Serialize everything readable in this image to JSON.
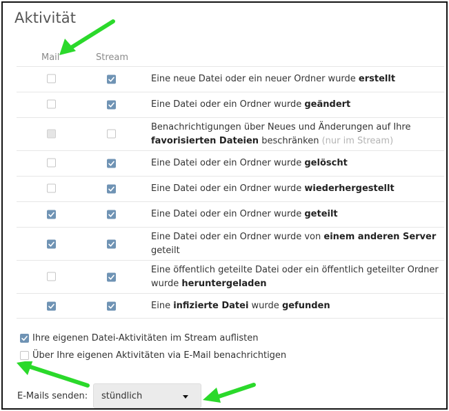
{
  "section": {
    "title": "Aktivität"
  },
  "columns": {
    "mail": "Mail",
    "stream": "Stream"
  },
  "rows": [
    {
      "mail": "unchecked",
      "stream": "checked",
      "text_before": "Eine neue Datei oder ein neuer Ordner wurde ",
      "bold": "erstellt",
      "text_after": ""
    },
    {
      "mail": "unchecked",
      "stream": "checked",
      "text_before": "Eine Datei oder ein Ordner wurde ",
      "bold": "geändert",
      "text_after": ""
    },
    {
      "mail": "disabled",
      "stream": "unchecked",
      "text_before": "Benachrichtigungen über Neues und Änderungen auf Ihre ",
      "bold": "favorisierten Dateien",
      "text_after": " beschränken ",
      "muted": "(nur im Stream)"
    },
    {
      "mail": "unchecked",
      "stream": "checked",
      "text_before": "Eine Datei oder ein Ordner wurde ",
      "bold": "gelöscht",
      "text_after": ""
    },
    {
      "mail": "unchecked",
      "stream": "checked",
      "text_before": "Eine Datei oder ein Ordner wurde ",
      "bold": "wiederhergestellt",
      "text_after": ""
    },
    {
      "mail": "checked",
      "stream": "checked",
      "text_before": "Eine Datei oder ein Ordner wurde ",
      "bold": "geteilt",
      "text_after": ""
    },
    {
      "mail": "checked",
      "stream": "checked",
      "text_before": "Eine Datei oder ein Ordner wurde von ",
      "bold": "einem anderen Server",
      "text_after": " geteilt"
    },
    {
      "mail": "unchecked",
      "stream": "checked",
      "text_before": "Eine öffentlich geteilte Datei oder ein öffentlich geteilter Ordner wurde ",
      "bold": "heruntergeladen",
      "text_after": ""
    },
    {
      "mail": "checked",
      "stream": "checked",
      "text_before": "Eine ",
      "bold": "infizierte Datei",
      "text_after": " wurde ",
      "bold2": "gefunden"
    }
  ],
  "options": {
    "own_in_stream": {
      "label": "Ihre eigenen Datei-Aktivitäten im Stream auflisten",
      "state": "checked"
    },
    "own_via_mail": {
      "label": "Über Ihre eigenen Aktivitäten via E-Mail benachrichtigen",
      "state": "unchecked"
    }
  },
  "send": {
    "label": "E-Mails senden:",
    "selected": "stündlich"
  },
  "colors": {
    "checkbox_checked": "#6f93b4",
    "annotation_arrow": "#2bd92b",
    "border": "#111111"
  },
  "icons": {
    "checkmark": "check-icon",
    "arrow": "annotation-arrow-icon",
    "caret": "caret-down-icon"
  }
}
